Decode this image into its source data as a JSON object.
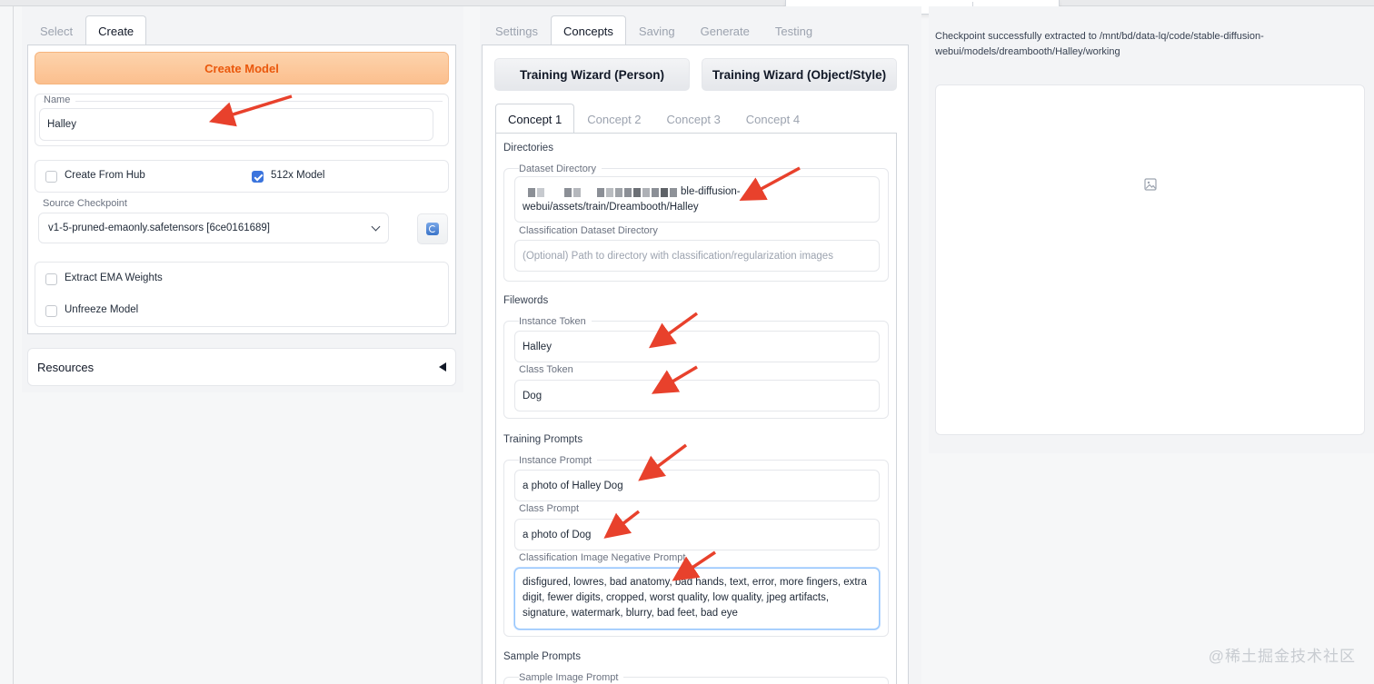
{
  "left": {
    "tabs": [
      {
        "label": "Select"
      },
      {
        "label": "Create"
      }
    ],
    "create_button": "Create Model",
    "name": {
      "label": "Name",
      "value": "Halley"
    },
    "create_from_hub": {
      "label": "Create From Hub",
      "checked": false
    },
    "model_512x": {
      "label": "512x Model",
      "checked": true
    },
    "source_checkpoint": {
      "label": "Source Checkpoint",
      "value": "v1-5-pruned-emaonly.safetensors [6ce0161689]"
    },
    "extract_ema": {
      "label": "Extract EMA Weights",
      "checked": false
    },
    "unfreeze": {
      "label": "Unfreeze Model",
      "checked": false
    },
    "resources": "Resources"
  },
  "mid": {
    "tabs": [
      {
        "label": "Settings"
      },
      {
        "label": "Concepts"
      },
      {
        "label": "Saving"
      },
      {
        "label": "Generate"
      },
      {
        "label": "Testing"
      }
    ],
    "wizard_person": "Training Wizard (Person)",
    "wizard_object": "Training Wizard (Object/Style)",
    "concept_tabs": [
      {
        "label": "Concept 1"
      },
      {
        "label": "Concept 2"
      },
      {
        "label": "Concept 3"
      },
      {
        "label": "Concept 4"
      }
    ],
    "directories": {
      "title": "Directories",
      "dataset_label": "Dataset Directory",
      "dataset_line1_tail": "ble-diffusion-",
      "dataset_line2": "webui/assets/train/Dreambooth/Halley",
      "class_dataset_label": "Classification Dataset Directory",
      "class_dataset_placeholder": "(Optional) Path to directory with classification/regularization images"
    },
    "filewords": {
      "title": "Filewords",
      "instance_token_label": "Instance Token",
      "instance_token": "Halley",
      "class_token_label": "Class Token",
      "class_token": "Dog"
    },
    "training_prompts": {
      "title": "Training Prompts",
      "instance_prompt_label": "Instance Prompt",
      "instance_prompt": "a photo of Halley Dog",
      "class_prompt_label": "Class Prompt",
      "class_prompt": "a photo of Dog",
      "negative_label": "Classification Image Negative Prompt",
      "negative_prompt": "disfigured, lowres, bad anatomy, bad hands, text, error, more fingers, extra digit, fewer digits, cropped, worst quality, low quality, jpeg artifacts, signature, watermark,  blurry, bad feet,  bad eye"
    },
    "sample_prompts": {
      "title": "Sample Prompts",
      "sample_image_label": "Sample Image Prompt"
    }
  },
  "right": {
    "status_line1": "Checkpoint successfully extracted to /mnt/bd/data-lq/code/stable-diffusion-",
    "status_line2": "webui/models/dreambooth/Halley/working",
    "image_icon": "image-placeholder-icon"
  },
  "watermark": "@稀土掘金技术社区",
  "colors": {
    "accent_orange": "#ea580c",
    "checkbox_blue": "#3b74dd",
    "annotation_red": "#e8412c"
  }
}
